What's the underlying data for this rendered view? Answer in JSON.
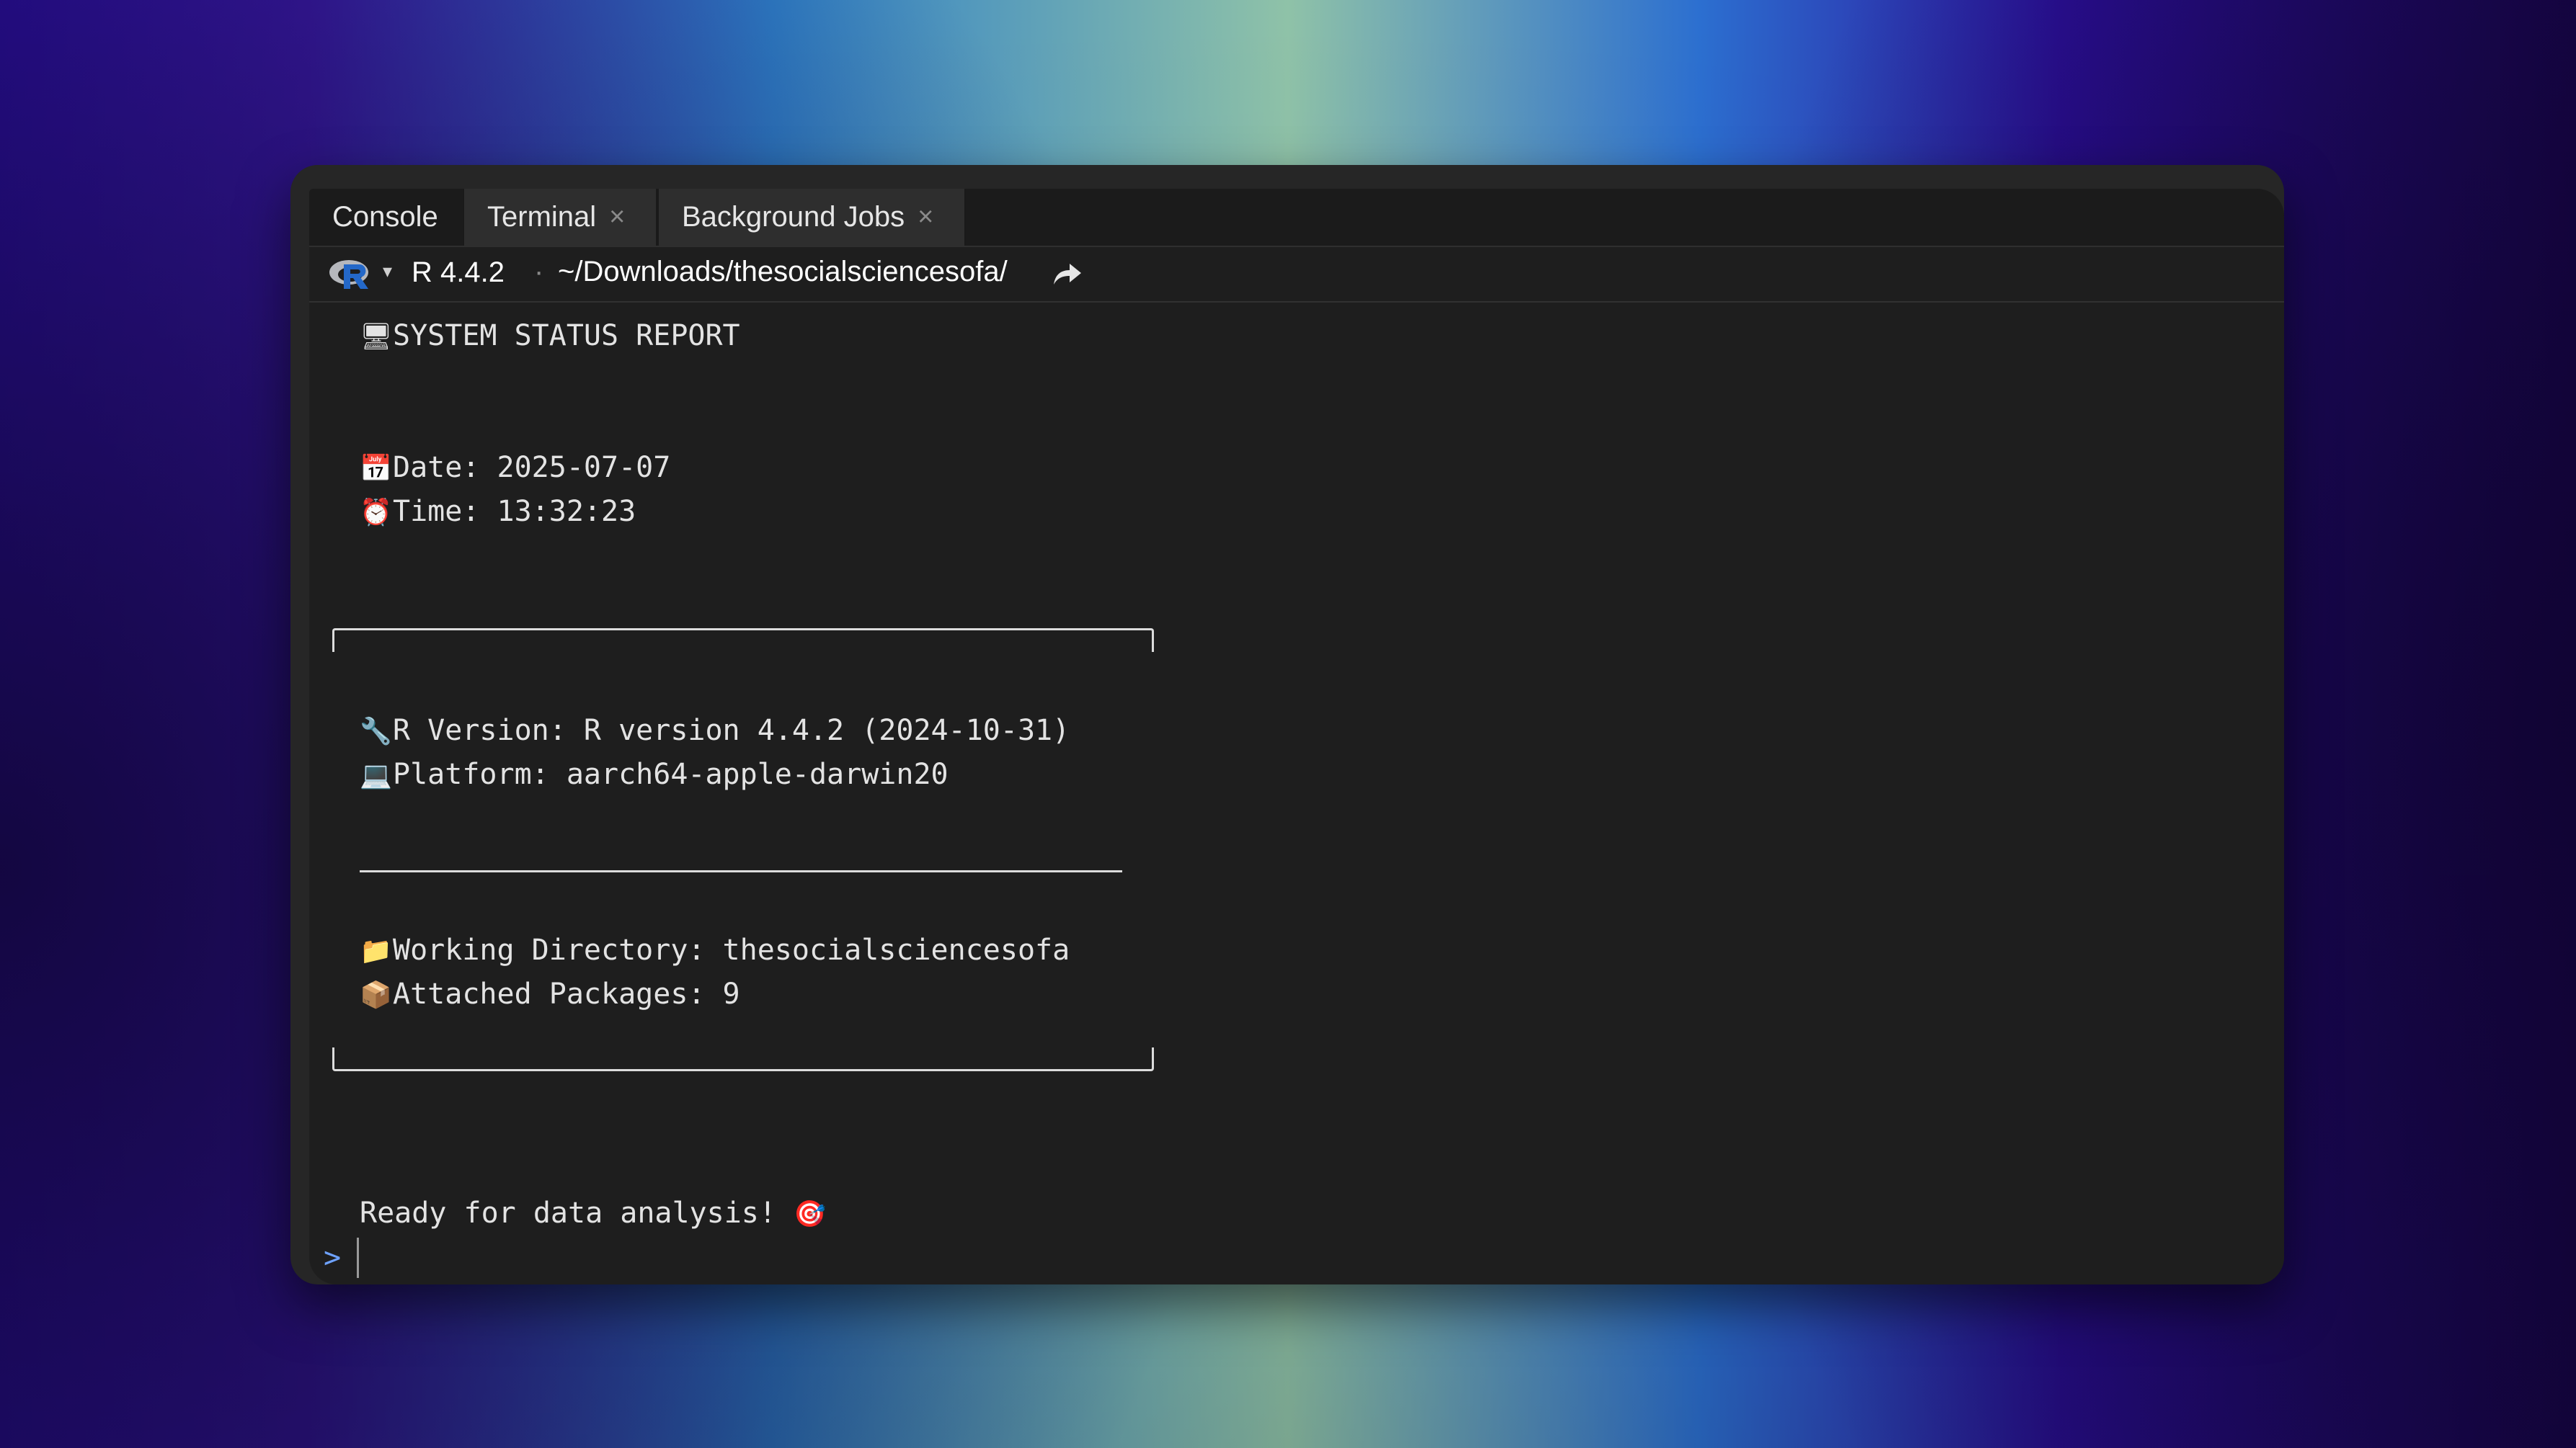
{
  "tabs": [
    {
      "label": "Console",
      "active": true,
      "closable": false
    },
    {
      "label": "Terminal",
      "active": false,
      "closable": true
    },
    {
      "label": "Background Jobs",
      "active": false,
      "closable": true
    }
  ],
  "close_glyph": "×",
  "toolbar": {
    "r_version": "R 4.4.2",
    "separator": "·",
    "path": "~/Downloads/thesocialsciencesofa/",
    "dropdown_glyph": "▾",
    "share_icon": "share-arrow-icon"
  },
  "console": {
    "title": {
      "icon": "🖥",
      "text": "SYSTEM STATUS REPORT"
    },
    "date": {
      "icon": "📅",
      "text": "Date: 2025-07-07"
    },
    "time": {
      "icon": "⏰",
      "text": "Time: 13:32:23"
    },
    "r_version": {
      "icon": "🔧",
      "text": "R Version: R version 4.4.2 (2024-10-31)"
    },
    "platform": {
      "icon": "💻",
      "text": "Platform: aarch64-apple-darwin20"
    },
    "working_dir": {
      "icon": "📁",
      "text": "Working Directory: thesocialsciencesofa"
    },
    "packages": {
      "icon": "📦",
      "text": "Attached Packages: 9"
    },
    "ready": {
      "text": "Ready for data analysis! ",
      "icon": "🎯"
    },
    "prompt": ">"
  },
  "colors": {
    "prompt": "#6ea2ff",
    "r_logo_blue": "#2468c8",
    "r_logo_grey": "#b6b8bd"
  }
}
